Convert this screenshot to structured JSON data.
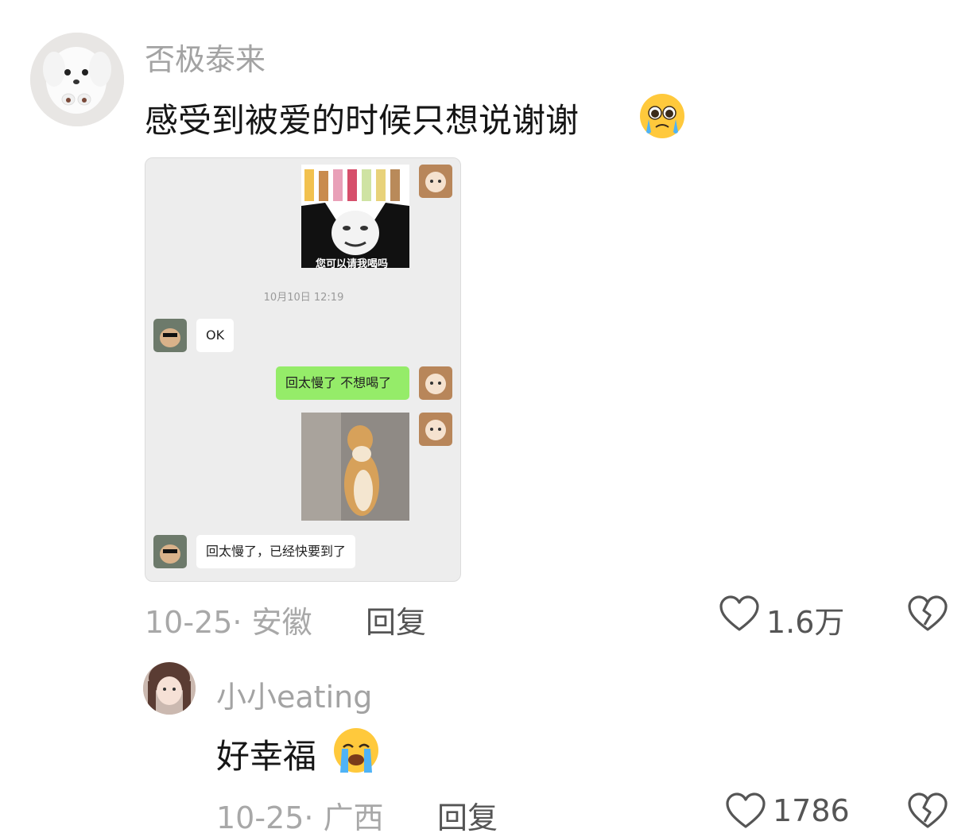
{
  "comment1": {
    "username": "否极泰来",
    "text": "感受到被爱的时候只想说谢谢",
    "emoji": "pleading-crying-face",
    "screenshot": {
      "sticker_caption": "您可以请我喝吗",
      "timestamp": "10月10日 12:19",
      "messages": [
        {
          "side": "left",
          "text": "OK"
        },
        {
          "side": "right",
          "text": "回太慢了 不想喝了"
        },
        {
          "side": "left",
          "text": "回太慢了，已经快要到了"
        }
      ]
    },
    "date_location": "10-25· 安徽",
    "reply_label": "回复",
    "like_count": "1.6万"
  },
  "comment2": {
    "username": "小小eating",
    "text": "好幸福",
    "emoji": "loudly-crying-face",
    "date_location": "10-25· 广西",
    "reply_label": "回复",
    "like_count": "1786"
  },
  "icons": {
    "like": "heart-outline-icon",
    "dislike": "broken-heart-icon"
  },
  "colors": {
    "username": "#a3a3a3",
    "meta": "#a8a8a8",
    "wechat_green": "#95ec69"
  }
}
